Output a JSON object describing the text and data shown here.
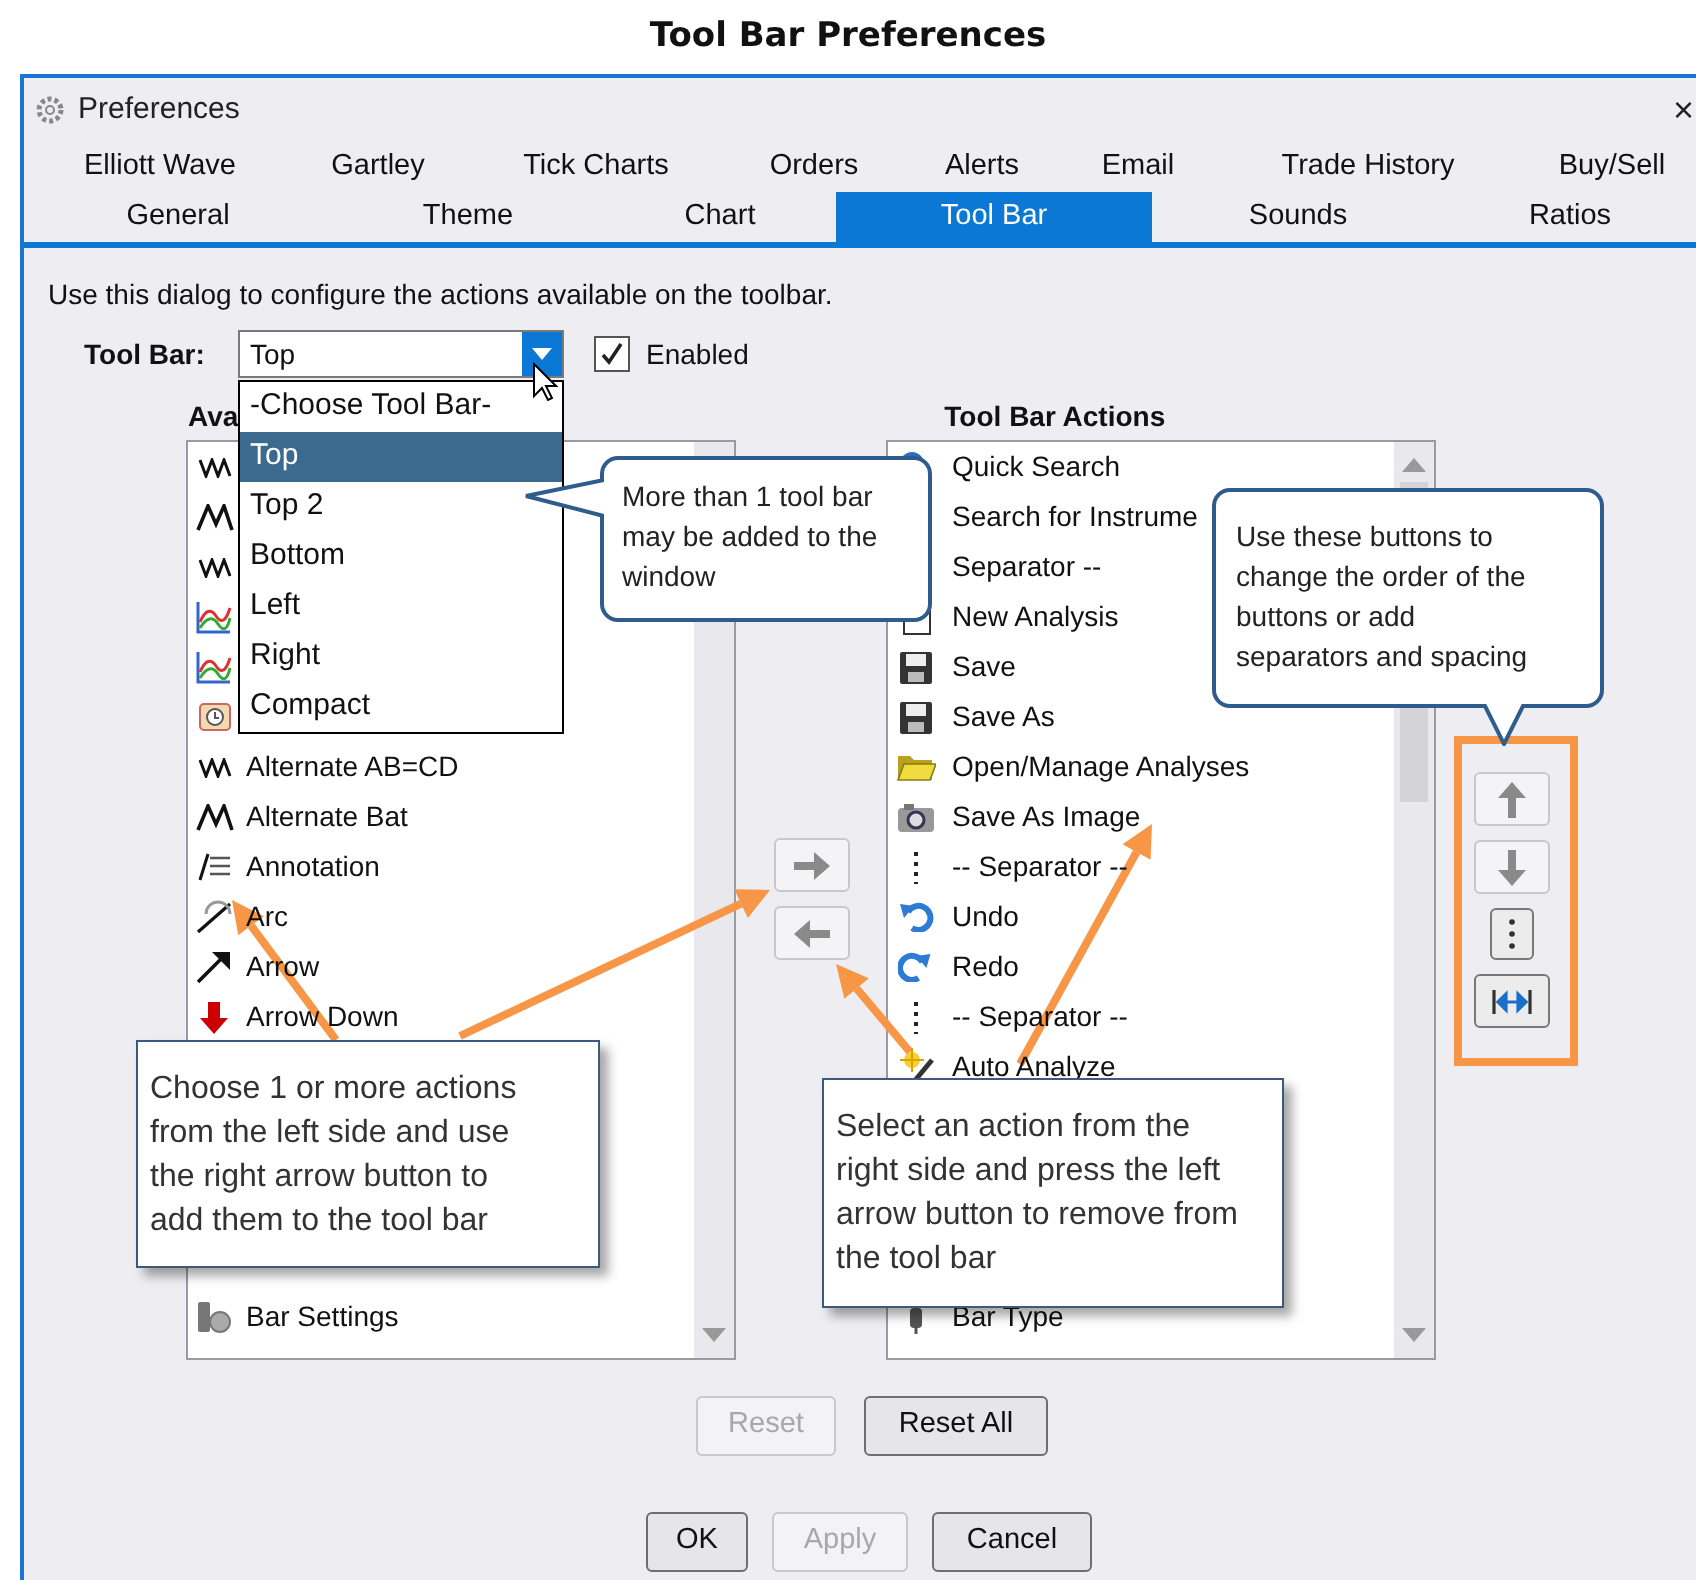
{
  "page_title": "Tool Bar Preferences",
  "window": {
    "title": "Preferences",
    "close": "×"
  },
  "tab_rows": [
    [
      {
        "label": "Elliott Wave",
        "selected": false
      },
      {
        "label": "Gartley",
        "selected": false
      },
      {
        "label": "Tick Charts",
        "selected": false
      },
      {
        "label": "Orders",
        "selected": false
      },
      {
        "label": "Alerts",
        "selected": false
      },
      {
        "label": "Email",
        "selected": false
      },
      {
        "label": "Trade History",
        "selected": false
      },
      {
        "label": "Buy/Sell",
        "selected": false
      }
    ],
    [
      {
        "label": "General",
        "selected": false
      },
      {
        "label": "Theme",
        "selected": false
      },
      {
        "label": "Chart",
        "selected": false
      },
      {
        "label": "Tool Bar",
        "selected": true
      },
      {
        "label": "Sounds",
        "selected": false
      },
      {
        "label": "Ratios",
        "selected": false
      }
    ]
  ],
  "description": "Use this dialog to configure the actions available on the toolbar.",
  "toolbar_select": {
    "label": "Tool Bar:",
    "value": "Top",
    "options": [
      {
        "label": "-Choose Tool Bar-",
        "selected": false
      },
      {
        "label": "Top",
        "selected": true
      },
      {
        "label": "Top 2",
        "selected": false
      },
      {
        "label": "Bottom",
        "selected": false
      },
      {
        "label": "Left",
        "selected": false
      },
      {
        "label": "Right",
        "selected": false
      },
      {
        "label": "Compact",
        "selected": false
      }
    ]
  },
  "enabled": {
    "label": "Enabled",
    "checked": true
  },
  "available": {
    "header": "Ava",
    "top_items": [
      {
        "kind": "action"
      },
      {
        "kind": "action"
      },
      {
        "kind": "action"
      },
      {
        "kind": "action"
      },
      {
        "kind": "action"
      },
      {
        "kind": "action"
      },
      {
        "kind": "action",
        "label": "Alternate AB=CD"
      },
      {
        "kind": "action",
        "label": "Alternate Bat"
      },
      {
        "kind": "action",
        "label": "Annotation"
      },
      {
        "kind": "action",
        "label": "Arc"
      },
      {
        "kind": "action",
        "label": "Arrow"
      },
      {
        "kind": "action",
        "label": "Arrow Down"
      }
    ],
    "bottom_items": [
      {
        "kind": "action"
      },
      {
        "kind": "action",
        "label": "Bar Settings"
      }
    ]
  },
  "actions": {
    "header": "Tool Bar Actions",
    "top_items": [
      {
        "kind": "action",
        "label": "Quick Search"
      },
      {
        "kind": "action",
        "label": "Search for Instrume"
      },
      {
        "kind": "separator",
        "label": "Separator --"
      },
      {
        "kind": "action",
        "label": "New Analysis"
      },
      {
        "kind": "action",
        "label": "Save"
      },
      {
        "kind": "action",
        "label": "Save As"
      },
      {
        "kind": "action",
        "label": "Open/Manage Analyses"
      },
      {
        "kind": "action",
        "label": "Save As Image"
      },
      {
        "kind": "separator",
        "label": "-- Separator --"
      },
      {
        "kind": "action",
        "label": "Undo"
      },
      {
        "kind": "action",
        "label": "Redo"
      },
      {
        "kind": "separator",
        "label": "-- Separator --"
      },
      {
        "kind": "action",
        "label": "Auto Analyze"
      }
    ],
    "bottom_items": [
      {
        "kind": "action",
        "label": "Bar Type"
      }
    ]
  },
  "reset_buttons": [
    {
      "label": "Reset",
      "disabled": true
    },
    {
      "label": "Reset All",
      "disabled": false
    }
  ],
  "dialog_buttons": [
    {
      "label": "OK",
      "disabled": false
    },
    {
      "label": "Apply",
      "disabled": true
    },
    {
      "label": "Cancel",
      "disabled": false
    }
  ],
  "callouts": [
    {
      "text": "More than 1 tool bar may be added to the window"
    },
    {
      "text": "Use these buttons to change the order of the buttons or add separators and spacing"
    },
    {
      "text": "Choose 1 or more actions from the left side and use the right arrow button to add them to the tool bar"
    },
    {
      "text": "Select an action from the right side and press the left arrow button to remove from the tool bar"
    }
  ]
}
